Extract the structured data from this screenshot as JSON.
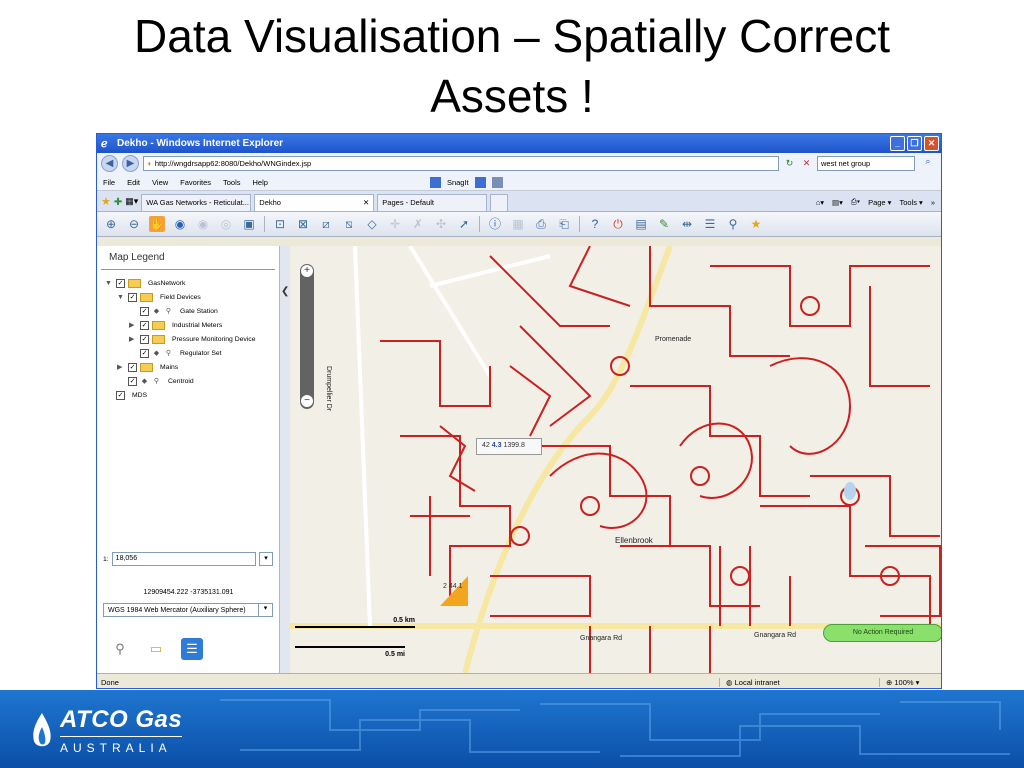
{
  "slide": {
    "title_line1": "Data Visualisation – Spatially Correct",
    "title_line2": "Assets !"
  },
  "browser": {
    "window_title": "Dekho - Windows Internet Explorer",
    "address": "http://wngdrsapp62:8080/Dekho/WNGindex.jsp",
    "search_value": "west net group",
    "menu": [
      "File",
      "Edit",
      "View",
      "Favorites",
      "Tools",
      "Help"
    ],
    "snagit_label": "SnagIt",
    "tabs": [
      "WA Gas Networks - Reticulat...",
      "Dekho",
      "Pages - Default"
    ],
    "page_menu": "Page",
    "tools_menu": "Tools",
    "status_left": "Done",
    "status_zone": "Local intranet",
    "status_zoom": "100%"
  },
  "legend": {
    "title": "Map Legend",
    "items": [
      {
        "label": "GasNetwork",
        "level": 0,
        "expand": "▼",
        "checked": true,
        "kind": "folder"
      },
      {
        "label": "Field Devices",
        "level": 1,
        "expand": "▼",
        "checked": true,
        "kind": "folder"
      },
      {
        "label": "Gate Station",
        "level": 2,
        "expand": "",
        "checked": true,
        "kind": "layer"
      },
      {
        "label": "Industrial Meters",
        "level": 2,
        "expand": "▶",
        "checked": true,
        "kind": "folder"
      },
      {
        "label": "Pressure Monitoring Device",
        "level": 2,
        "expand": "▶",
        "checked": true,
        "kind": "folder"
      },
      {
        "label": "Regulator Set",
        "level": 2,
        "expand": "",
        "checked": true,
        "kind": "layer"
      },
      {
        "label": "Mains",
        "level": 1,
        "expand": "▶",
        "checked": true,
        "kind": "folder"
      },
      {
        "label": "Centroid",
        "level": 1,
        "expand": "",
        "checked": true,
        "kind": "layer"
      },
      {
        "label": "MDS",
        "level": 0,
        "expand": "",
        "checked": true,
        "kind": "none"
      }
    ],
    "scale_prefix": "1:",
    "scale_value": "18,056",
    "coordinates": "12909454.222 -3735131.091",
    "projection": "WGS 1984 Web Mercator (Auxiliary Sphere)"
  },
  "map": {
    "tooltip_a": "42",
    "tooltip_b": "4.3",
    "tooltip_c": "1399.8",
    "marker_label": "2 44.1",
    "status_pill": "No Action Required",
    "scale_km": "0.5 km",
    "scale_mi": "0.5 mi",
    "place_label": "Ellenbrook",
    "road_labels": [
      "Gnangara Rd",
      "Gnangara Rd",
      "Drumpellier Dr",
      "Promenade"
    ]
  },
  "footer": {
    "brand": "ATCO Gas",
    "sub": "AUSTRALIA"
  },
  "colors": {
    "pipe": "#cc1f1f",
    "road_major": "#f6e7a3",
    "footer_blue": "#0b4fa8"
  }
}
